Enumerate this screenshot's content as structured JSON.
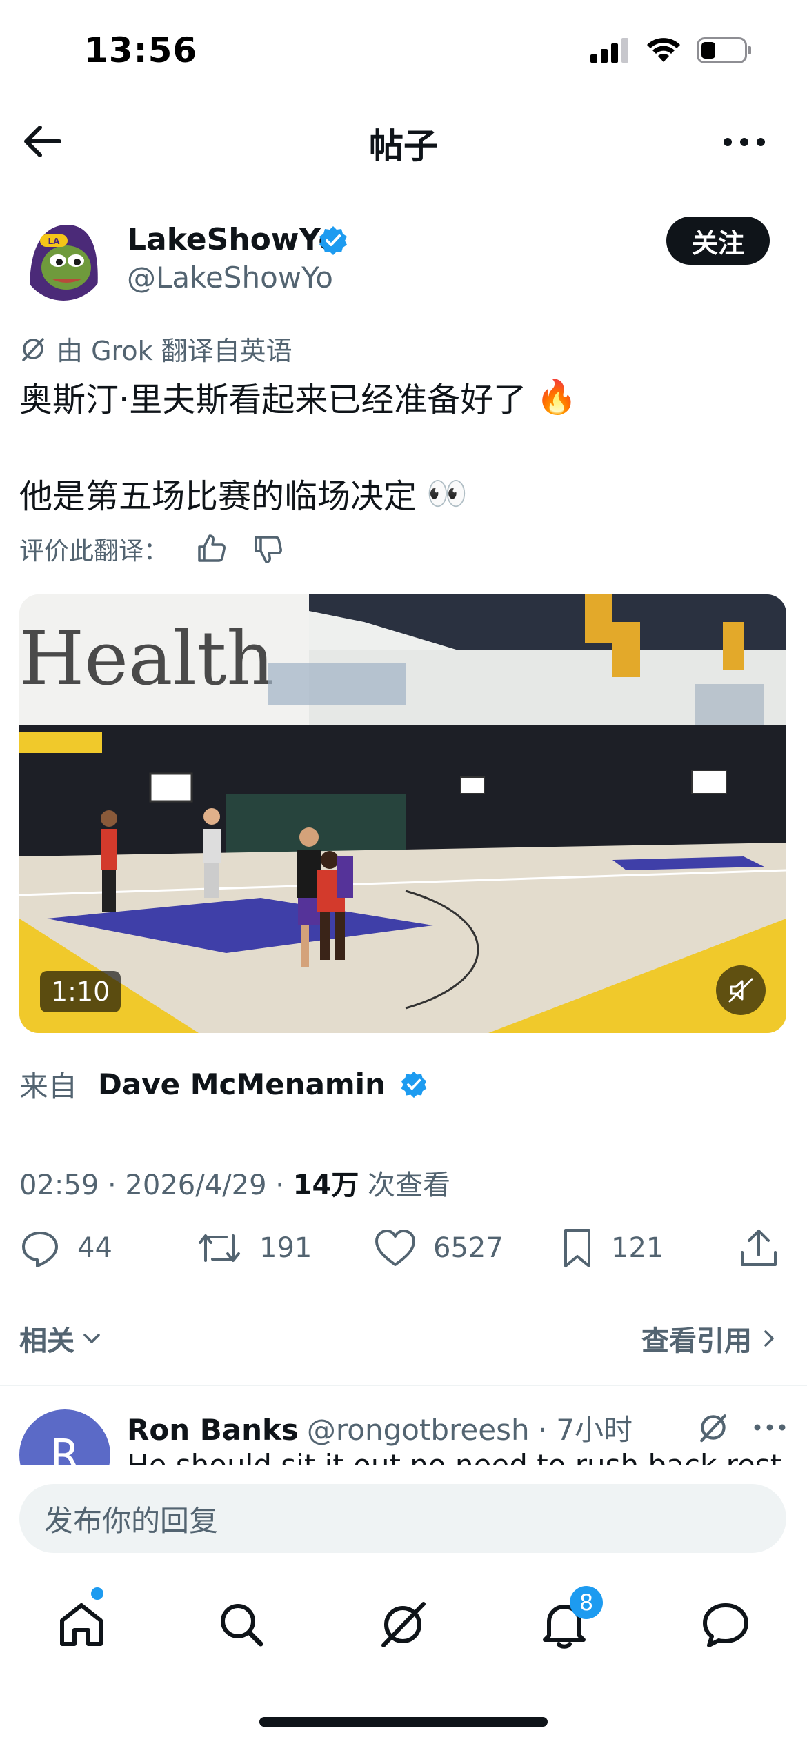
{
  "status_bar": {
    "time": "13:56"
  },
  "nav": {
    "title": "帖子"
  },
  "post": {
    "author_name": "LakeShowYo",
    "author_handle": "@LakeShowYo",
    "follow_label": "关注",
    "translation_note": "由 Grok 翻译自英语",
    "text_line1": "奥斯汀·里夫斯看起来已经准备好了",
    "text_line1_emoji": "🔥",
    "text_line2": "他是第五场比赛的临场决定",
    "text_line2_emoji": "👀",
    "rate_translation": "评价此翻译：",
    "video_duration": "1:10",
    "source_prefix": "来自",
    "source_name": "Dave McMenamin",
    "meta_time": "02:59 · 2026/4/29 · ",
    "meta_views": "14万",
    "meta_views_suffix": " 次查看",
    "replies": "44",
    "reposts": "191",
    "likes": "6527",
    "bookmarks": "121",
    "related_label": "相关",
    "quotes_label": "查看引用"
  },
  "reply": {
    "avatar_letter": "R",
    "name": "Ron Banks",
    "handle": "@rongotbreesh",
    "time": "· 7小时",
    "text": "He should sit it out no need to rush back rest up"
  },
  "composer": {
    "placeholder": "发布你的回复"
  },
  "tabbar": {
    "notifications_badge": "8"
  },
  "colors": {
    "accent": "#1d9bf0",
    "text": "#0f1419",
    "muted": "#536471"
  },
  "icons": [
    "back-arrow-icon",
    "more-icon",
    "verified-icon",
    "grok-icon",
    "thumbs-up-icon",
    "thumbs-down-icon",
    "mute-icon",
    "reply-icon",
    "repost-icon",
    "like-icon",
    "bookmark-icon",
    "share-icon",
    "home-icon",
    "search-icon",
    "grok-tab-icon",
    "notifications-icon",
    "messages-icon"
  ]
}
